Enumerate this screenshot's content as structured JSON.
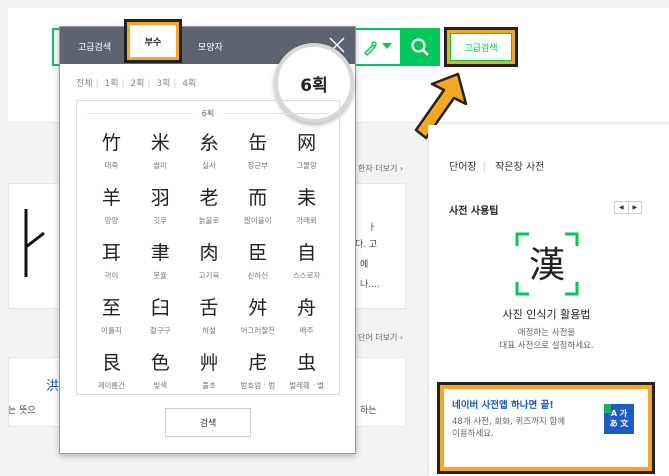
{
  "search": {
    "advanced_button": "고급검색"
  },
  "left": {
    "more_hanja": "한자 더보기 ›",
    "more_words": "단어 더보기 ›",
    "fragments": [
      "ㅏ",
      "다. 고",
      "에",
      "나....",
      "하는",
      "는 뜻으"
    ],
    "blue_char": "洪"
  },
  "sidebar": {
    "tabs": [
      "단어장",
      "작은창 사전"
    ],
    "title": "사전 사용팁",
    "subtitle": "사진 인식기 활용법",
    "desc_lines": [
      "애정하는 사전을",
      "대표 사전으로 설정하세요."
    ],
    "pager": [
      "◀",
      "▶"
    ],
    "ad": {
      "title": "네이버 사전앱 하나면 끝!",
      "desc": "48개 사전, 회화, 퀴즈까지 함께 이용하세요.",
      "icon_top": "A 가",
      "icon_bottom": "あ 文"
    }
  },
  "popup": {
    "tabs": [
      "고급검색",
      "부수",
      "모양자"
    ],
    "stroke_counts": [
      "전체",
      "1획",
      "2획",
      "3획",
      "4획"
    ],
    "magnified": "6획",
    "pager": [
      "◀",
      "▶"
    ],
    "grid_label": "6획",
    "chars": [
      {
        "glyph": "竹",
        "meaning": "대죽"
      },
      {
        "glyph": "米",
        "meaning": "쌀미"
      },
      {
        "glyph": "糸",
        "meaning": "실사"
      },
      {
        "glyph": "缶",
        "meaning": "장군부"
      },
      {
        "glyph": "网",
        "meaning": "그물망"
      },
      {
        "glyph": "羊",
        "meaning": "양양"
      },
      {
        "glyph": "羽",
        "meaning": "깃우"
      },
      {
        "glyph": "老",
        "meaning": "늙을로"
      },
      {
        "glyph": "而",
        "meaning": "말이을이"
      },
      {
        "glyph": "耒",
        "meaning": "가래뢰"
      },
      {
        "glyph": "耳",
        "meaning": "귀이"
      },
      {
        "glyph": "聿",
        "meaning": "붓율"
      },
      {
        "glyph": "肉",
        "meaning": "고기육"
      },
      {
        "glyph": "臣",
        "meaning": "신하신"
      },
      {
        "glyph": "自",
        "meaning": "스스로자"
      },
      {
        "glyph": "至",
        "meaning": "이를지"
      },
      {
        "glyph": "臼",
        "meaning": "절구구"
      },
      {
        "glyph": "舌",
        "meaning": "혀설"
      },
      {
        "glyph": "舛",
        "meaning": "어그러질천"
      },
      {
        "glyph": "舟",
        "meaning": "배주"
      },
      {
        "glyph": "艮",
        "meaning": "괘이름간"
      },
      {
        "glyph": "色",
        "meaning": "빛색"
      },
      {
        "glyph": "艸",
        "meaning": "풀초"
      },
      {
        "glyph": "虍",
        "meaning": "범호엄 · 범"
      },
      {
        "glyph": "虫",
        "meaning": "벌레훼 · 벌"
      }
    ],
    "search_button": "검색"
  },
  "colors": {
    "brand_green": "#03c75a",
    "highlight_orange": "#f5a623",
    "header_gray": "#5d6470"
  }
}
